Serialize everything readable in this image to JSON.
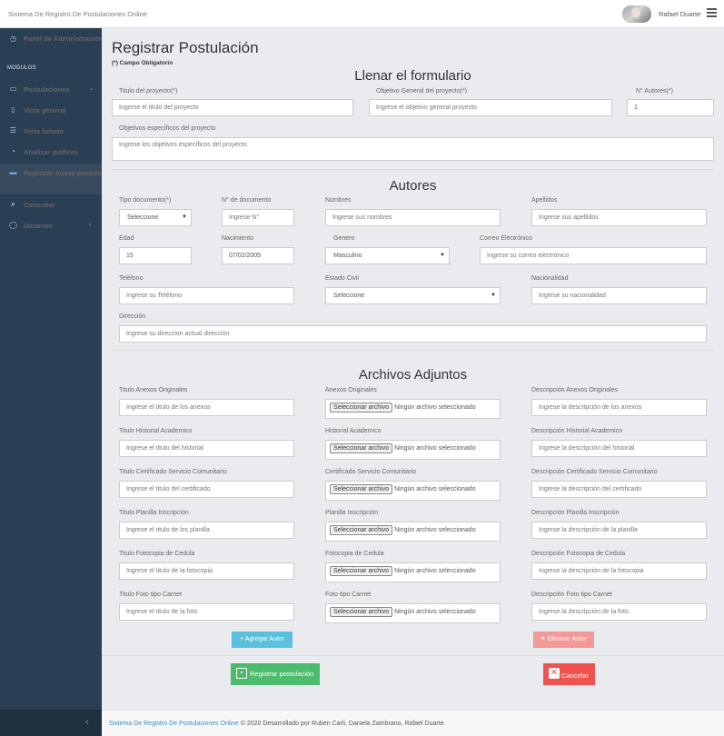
{
  "topbar": {
    "brand": "Sistema De Registro De Postulaciones Online",
    "user_name": "Rafael Duarte"
  },
  "sidebar": {
    "dashboard": "Panel de Administración",
    "section": "MODULOS",
    "items": [
      "Postulaciones",
      "Vista general",
      "Vista listado",
      "Analizar gráficos",
      "Registrar nueva postulación",
      "Consultar",
      "Usuarios"
    ]
  },
  "page": {
    "title": "Registrar Postulación",
    "required_note": "(*) Campo Obligatorio"
  },
  "form": {
    "section_title": "Llenar el formulario",
    "titulo_label": "Titulo del proyecto(*)",
    "titulo_ph": "Ingrese el titulo del proyecto",
    "objetivo_label": "Objetivo General del proyecto(*)",
    "objetivo_ph": "Ingrese el objetivo general proyecto",
    "autores_label": "N° Autores(*)",
    "autores_value": "1",
    "especificos_label": "Objetivos específicos del proyecto",
    "especificos_ph": "Ingrese los objetivos específicos del proyecto"
  },
  "autores": {
    "section_title": "Autores",
    "tipo_label": "Tipo documento(*)",
    "tipo_value": "Seleccione",
    "ndoc_label": "N° de documento",
    "ndoc_ph": "Ingrese N°",
    "nombres_label": "Nombres",
    "nombres_ph": "Ingrese sus nombres",
    "apellidos_label": "Apellidos",
    "apellidos_ph": "Ingrese sus apellidos",
    "edad_label": "Edad",
    "edad_value": "15",
    "nac_label": "Nacimiento",
    "nac_value": "07/02/2005",
    "genero_label": "Genero",
    "genero_value": "Masculino",
    "correo_label": "Correo Electrónico",
    "correo_ph": "Ingrese su correo electrónico",
    "tel_label": "Teléfono",
    "tel_ph": "Ingrese su Teléfono",
    "civil_label": "Estado Civil",
    "civil_value": "Seleccione",
    "nacionalidad_label": "Nacionalidad",
    "nacionalidad_ph": "Ingrese su nacionalidad",
    "dir_label": "Dirección",
    "dir_ph": "Ingrese su direccion actual dirección"
  },
  "adjuntos": {
    "section_title": "Archivos Adjuntos",
    "file_button": "Seleccionar archivo",
    "file_none": "Ningún archivo seleccionado",
    "rows": [
      {
        "t_label": "Titulo Anexos Originales",
        "t_ph": "Ingrese el titulo de los anexos",
        "f_label": "Anexos Originales",
        "d_label": "Descripción Anexos Originales",
        "d_ph": "Ingrese la descripción de los anexos"
      },
      {
        "t_label": "Titulo Historial Academico",
        "t_ph": "Ingrese el titulo del historial",
        "f_label": "Historial Academico",
        "d_label": "Descripción Historial Academico",
        "d_ph": "Ingrese la descripción del historial"
      },
      {
        "t_label": "Titulo Certificado Servicio Comunitario",
        "t_ph": "Ingrese el titulo del certificado",
        "f_label": "Certificado Servicio Comunitario",
        "d_label": "Descripción Certificado Servicio Comunitario",
        "d_ph": "Ingrese la descripción del certificado"
      },
      {
        "t_label": "Titulo Planilla Inscripción",
        "t_ph": "Ingrese el titulo de los planilla",
        "f_label": "Planilla Inscripción",
        "d_label": "Descripción Planilla Inscripción",
        "d_ph": "Ingrese la descripción de la planilla"
      },
      {
        "t_label": "Titulo Fotocopia de Cedula",
        "t_ph": "Ingrese el titulo de la fotocopia",
        "f_label": "Fotocopia de Cedula",
        "d_label": "Descripción Fotocopia de Cedula",
        "d_ph": "Ingrese la descripción de la fotocopia"
      },
      {
        "t_label": "Titulo Foto tipo Carnet",
        "t_ph": "Ingrese el titulo de la foto",
        "f_label": "Foto tipo Carnet",
        "d_label": "Descripción Foto tipo Carnet",
        "d_ph": "Ingrese la descripción de la foto"
      }
    ]
  },
  "buttons": {
    "add_author": "+ Agregar Autor",
    "remove_author": "✕ Eliminar Autor",
    "submit": "Registrar postulación",
    "cancel": "Cancelar"
  },
  "footer": {
    "link": "Sistema De Registro De Postulaciones Online",
    "text": " © 2020 Desarrollado por Ruben Carli, Daniela Zambrano, Rafael Duarte."
  },
  "colors": {
    "sidebar": "#2a3f54",
    "info": "#5bc0de",
    "success": "#4cbb6c",
    "danger": "#ef5350"
  }
}
